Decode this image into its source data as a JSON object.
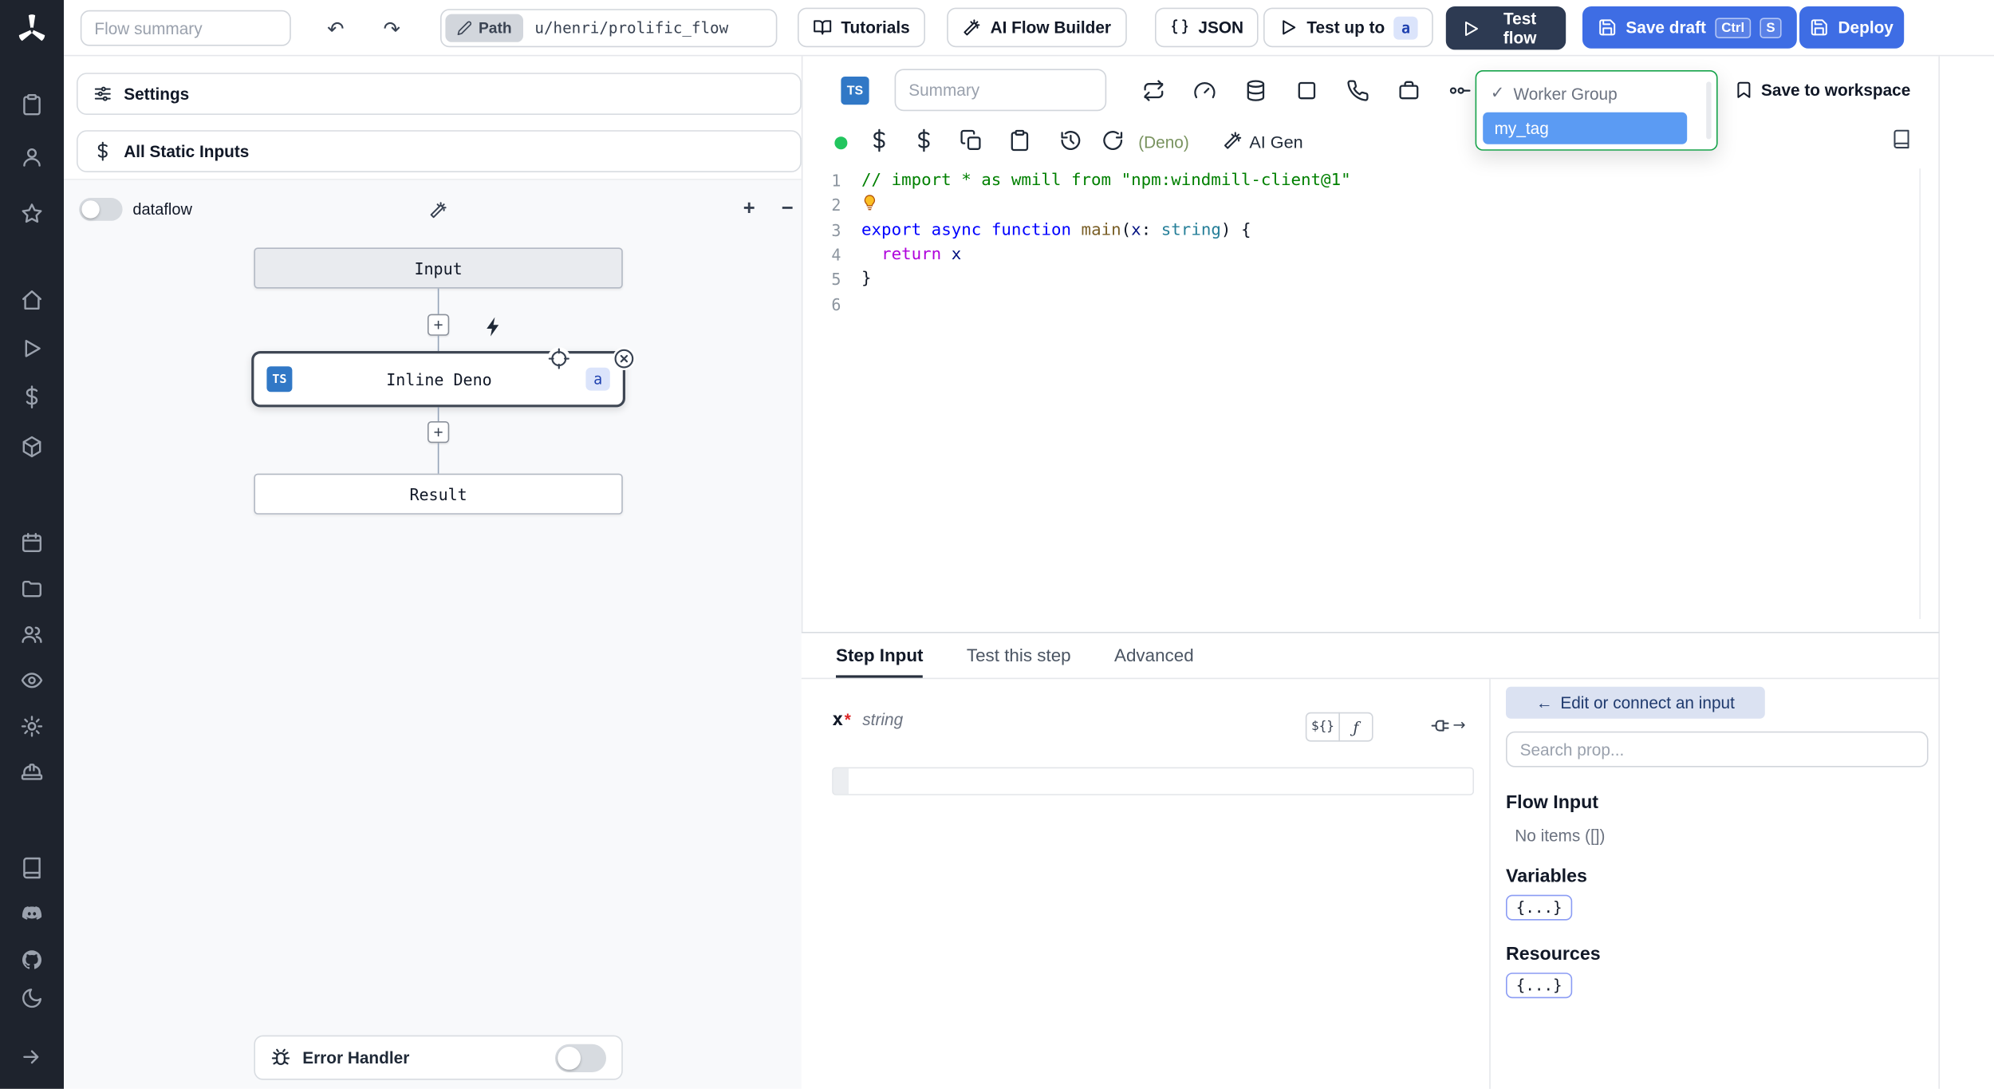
{
  "colors": {
    "sidebar_bg": "#1e232d",
    "accent_blue": "#3e6de4",
    "dark_button": "#2d3a52",
    "tag_blue": "#5b9bf3",
    "chip_blue_bg": "#dbe4fb",
    "chip_blue_text": "#1e40af",
    "green_dot": "#22c55e",
    "dropdown_border": "#16a34a",
    "deno_text": "#79935f",
    "code_comment": "#008000",
    "code_keyword": "#0000ff",
    "code_control": "#af00db",
    "code_type": "#267f99",
    "code_fn": "#795e26",
    "code_var": "#001080"
  },
  "icons": {
    "undo": "↶",
    "redo": "↷",
    "zoom_in": "+",
    "zoom_out": "−",
    "plus": "+",
    "check": "✓",
    "arrow_left": "←",
    "arrow_right": "→",
    "braces_chip": "${}",
    "fn_chip": "ƒ"
  },
  "sidebar": {
    "icons": [
      "windmill-logo",
      "clipboard",
      "user",
      "star",
      "home",
      "play",
      "dollar",
      "cube",
      "calendar",
      "folder",
      "users",
      "eye",
      "gear",
      "hard-hat",
      "book",
      "discord",
      "github",
      "moon",
      "expand"
    ]
  },
  "topbar": {
    "flow_summary_placeholder": "Flow summary",
    "path_label": "Path",
    "path_value": "u/henri/prolific_flow",
    "tutorials_label": "Tutorials",
    "ai_flow_builder_label": "AI Flow Builder",
    "json_label": "JSON",
    "test_up_to_label": "Test up to",
    "test_up_to_badge": "a",
    "test_flow_label": "Test flow",
    "save_draft_label": "Save draft",
    "save_draft_kbd": [
      "Ctrl",
      "S"
    ],
    "deploy_label": "Deploy"
  },
  "flow_panel": {
    "settings_label": "Settings",
    "all_static_inputs_label": "All Static Inputs",
    "dataflow_label": "dataflow",
    "nodes": {
      "input_label": "Input",
      "inline_deno_label": "Inline Deno",
      "inline_deno_lang": "TS",
      "inline_deno_badge": "a",
      "result_label": "Result"
    },
    "error_handler_label": "Error Handler"
  },
  "editor": {
    "lang_badge": "TS",
    "summary_placeholder": "Summary",
    "worker_group_label": "Worker Group",
    "selected_tag": "my_tag",
    "save_to_workspace_label": "Save to workspace",
    "deno_label": "(Deno)",
    "ai_gen_label": "AI Gen",
    "code": {
      "lines": [
        {
          "n": "1",
          "tokens": [
            {
              "c": "comment",
              "t": "// import * as wmill from \"npm:windmill-client@1\""
            }
          ]
        },
        {
          "n": "2",
          "tokens": [
            {
              "c": "bulb",
              "t": ""
            }
          ]
        },
        {
          "n": "3",
          "tokens": [
            {
              "c": "kw",
              "t": "export"
            },
            {
              "c": "plain",
              "t": " "
            },
            {
              "c": "kw",
              "t": "async"
            },
            {
              "c": "plain",
              "t": " "
            },
            {
              "c": "kw",
              "t": "function"
            },
            {
              "c": "plain",
              "t": " "
            },
            {
              "c": "fn",
              "t": "main"
            },
            {
              "c": "plain",
              "t": "("
            },
            {
              "c": "var",
              "t": "x"
            },
            {
              "c": "plain",
              "t": ": "
            },
            {
              "c": "type",
              "t": "string"
            },
            {
              "c": "plain",
              "t": ") {"
            }
          ]
        },
        {
          "n": "4",
          "tokens": [
            {
              "c": "plain",
              "t": "  "
            },
            {
              "c": "ctrl",
              "t": "return"
            },
            {
              "c": "plain",
              "t": " "
            },
            {
              "c": "var",
              "t": "x"
            }
          ]
        },
        {
          "n": "5",
          "tokens": [
            {
              "c": "plain",
              "t": "}"
            }
          ]
        },
        {
          "n": "6",
          "tokens": []
        }
      ]
    }
  },
  "bottom": {
    "tabs": [
      "Step Input",
      "Test this step",
      "Advanced"
    ],
    "active_tab": 0,
    "arg_name": "x",
    "arg_required": "*",
    "arg_type": "string",
    "connect_label": "Edit or connect an input",
    "search_placeholder": "Search prop...",
    "flow_input_title": "Flow Input",
    "no_items_label": "No items ([])",
    "variables_title": "Variables",
    "variables_badge": "{...}",
    "resources_title": "Resources",
    "resources_badge": "{...}"
  }
}
